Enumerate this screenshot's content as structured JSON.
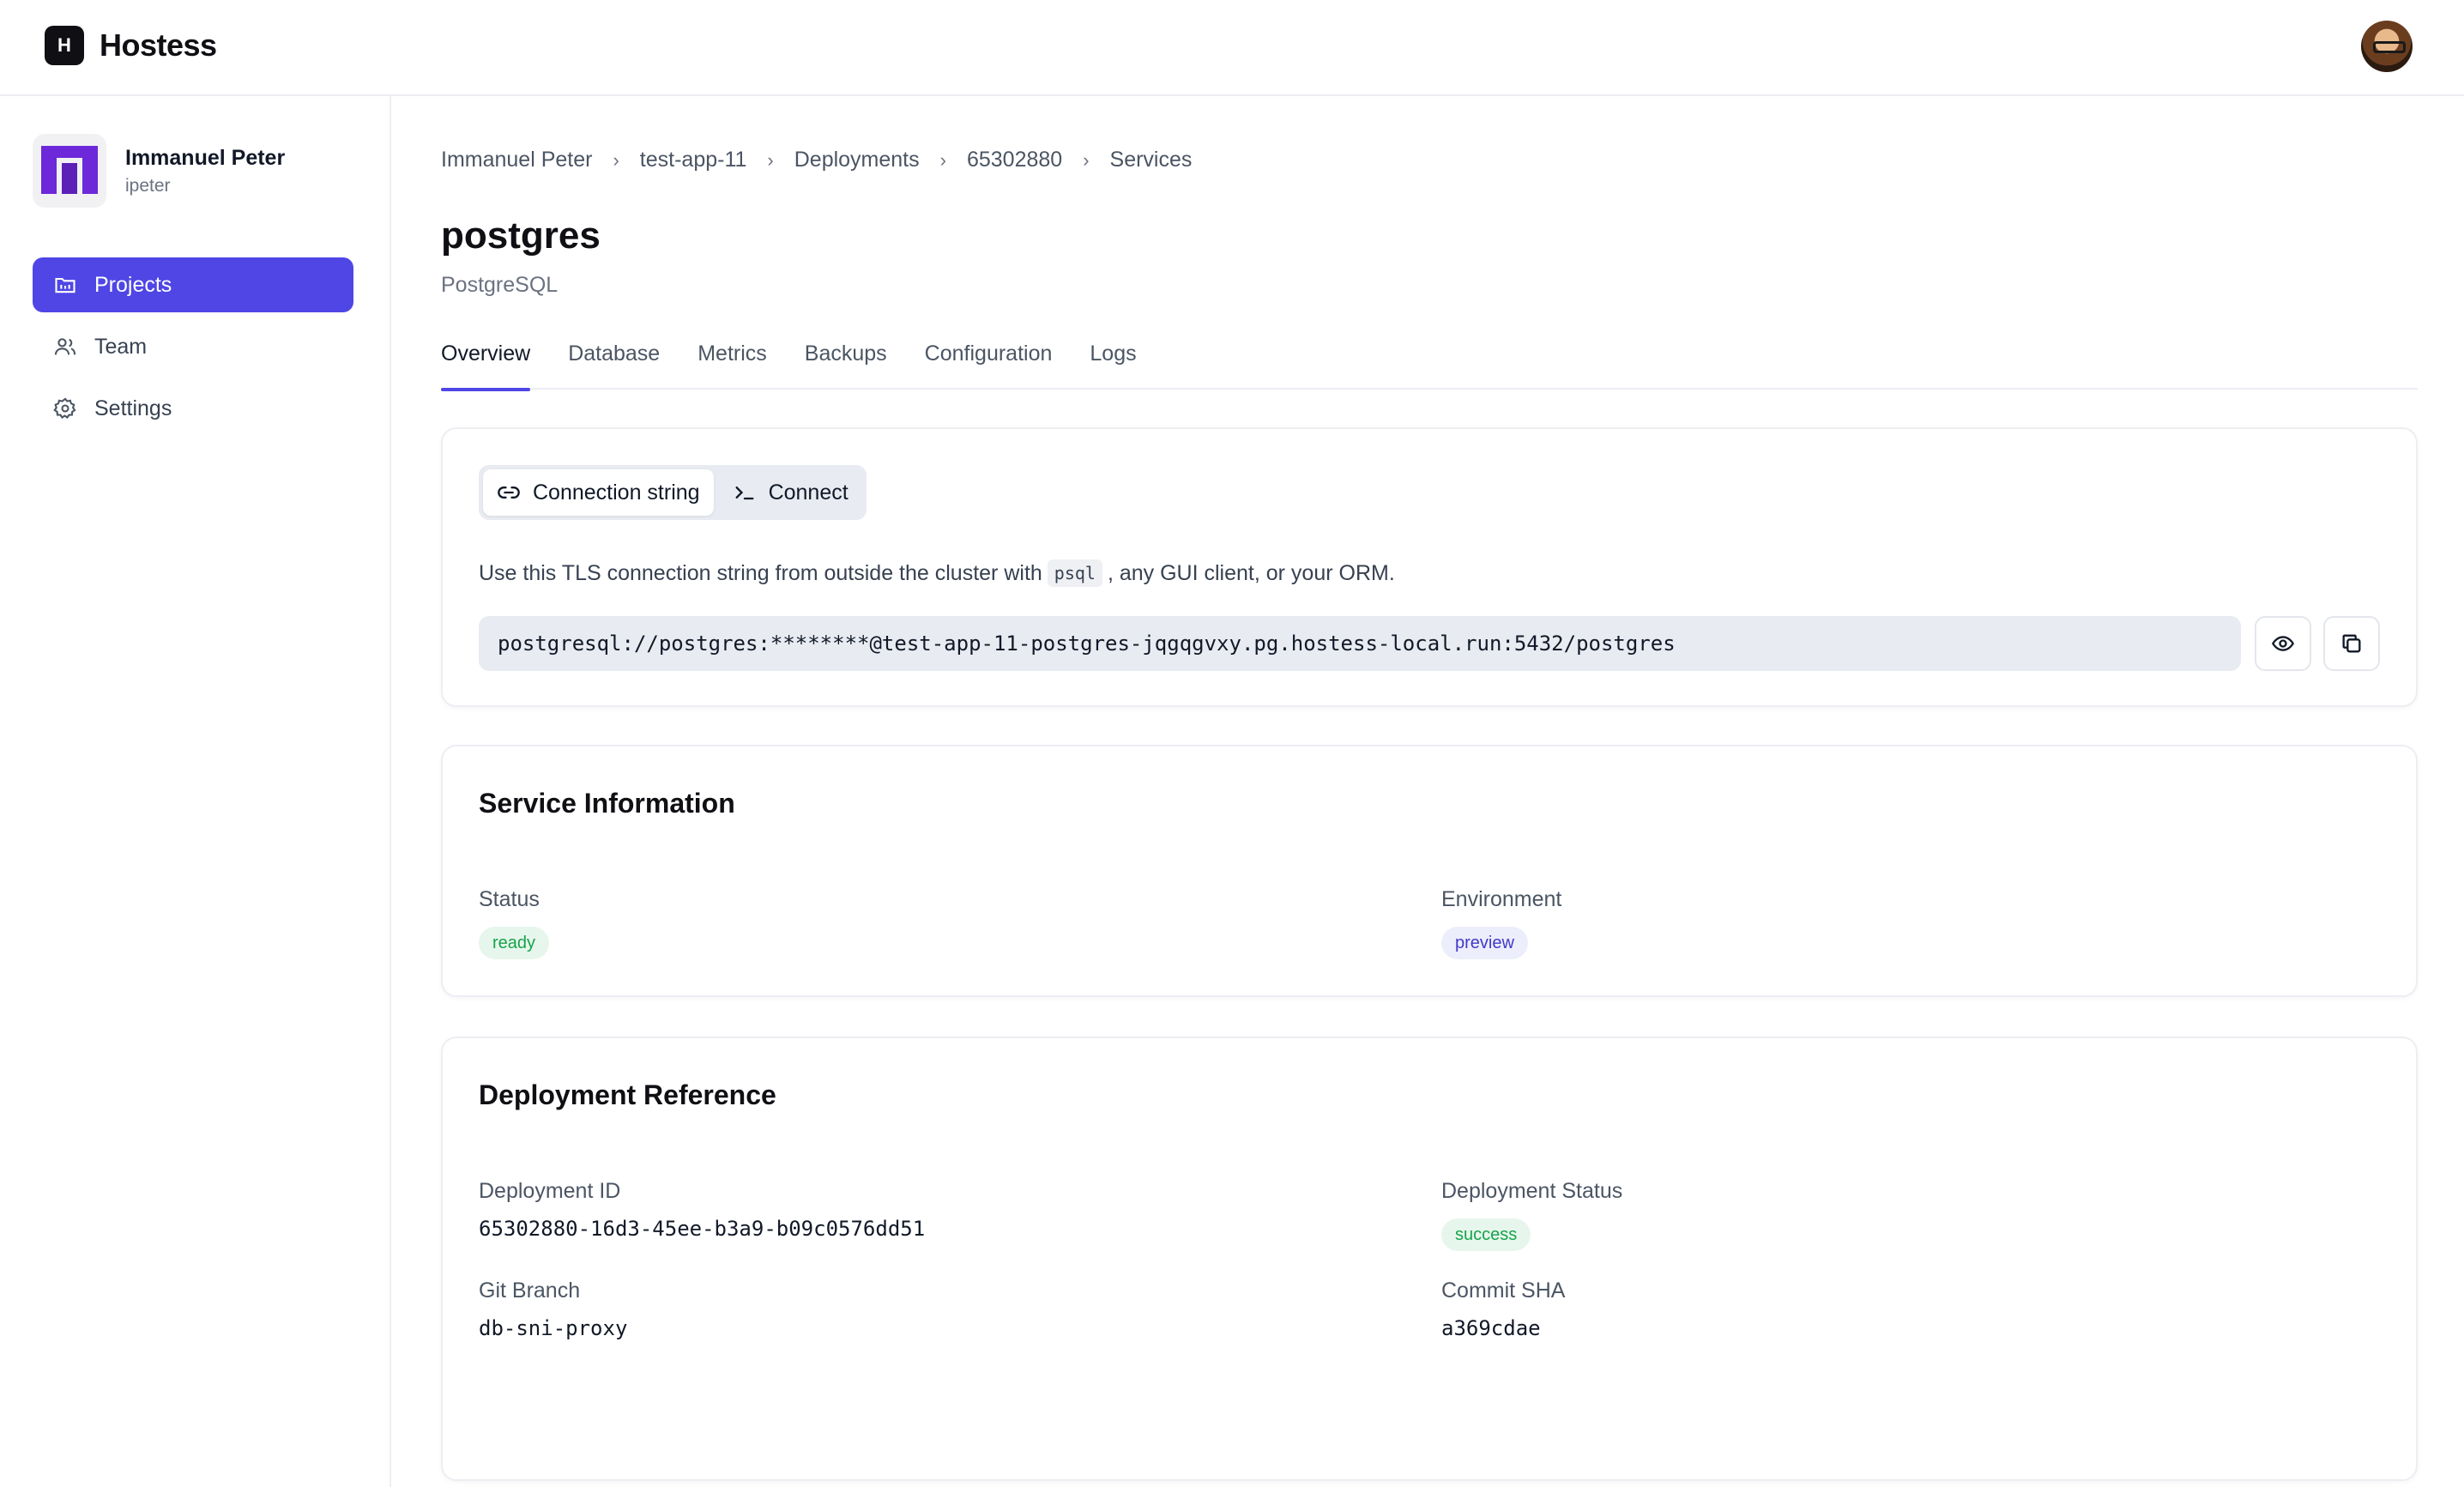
{
  "app": {
    "name": "Hostess",
    "logo_letter": "H"
  },
  "user": {
    "name": "Immanuel Peter",
    "handle": "ipeter"
  },
  "sidebar": {
    "items": [
      {
        "label": "Projects",
        "icon": "folder-icon",
        "active": true
      },
      {
        "label": "Team",
        "icon": "users-icon",
        "active": false
      },
      {
        "label": "Settings",
        "icon": "gear-icon",
        "active": false
      }
    ]
  },
  "breadcrumb": [
    "Immanuel Peter",
    "test-app-11",
    "Deployments",
    "65302880",
    "Services"
  ],
  "service": {
    "name": "postgres",
    "type": "PostgreSQL"
  },
  "tabs": [
    {
      "label": "Overview",
      "active": true
    },
    {
      "label": "Database",
      "active": false
    },
    {
      "label": "Metrics",
      "active": false
    },
    {
      "label": "Backups",
      "active": false
    },
    {
      "label": "Configuration",
      "active": false
    },
    {
      "label": "Logs",
      "active": false
    }
  ],
  "connection": {
    "segments": [
      {
        "label": "Connection string",
        "icon": "link-icon",
        "active": true
      },
      {
        "label": "Connect",
        "icon": "terminal-icon",
        "active": false
      }
    ],
    "desc_before": "Use this TLS connection string from outside the cluster with",
    "desc_code": "psql",
    "desc_after": ", any GUI client, or your ORM.",
    "string": "postgresql://postgres:********@test-app-11-postgres-jqgqgvxy.pg.hostess-local.run:5432/postgres"
  },
  "service_info": {
    "title": "Service Information",
    "status_label": "Status",
    "status_value": "ready",
    "environment_label": "Environment",
    "environment_value": "preview"
  },
  "deployment_ref": {
    "title": "Deployment Reference",
    "id_label": "Deployment ID",
    "id_value": "65302880-16d3-45ee-b3a9-b09c0576dd51",
    "status_label": "Deployment Status",
    "status_value": "success",
    "branch_label": "Git Branch",
    "branch_value": "db-sni-proxy",
    "sha_label": "Commit SHA",
    "sha_value": "a369cdae"
  },
  "colors": {
    "accent": "#4f46e5",
    "success": "#16a34a",
    "preview": "#4338ca"
  }
}
